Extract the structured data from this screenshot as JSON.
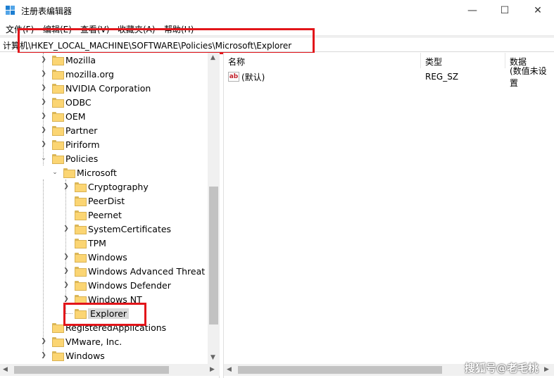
{
  "window": {
    "title": "注册表编辑器",
    "minimize": "—",
    "maximize": "☐",
    "close": "✕"
  },
  "menu": [
    "文件(F)",
    "编辑(E)",
    "查看(V)",
    "收藏夹(A)",
    "帮助(H)"
  ],
  "address": "计算机\\HKEY_LOCAL_MACHINE\\SOFTWARE\\Policies\\Microsoft\\Explorer",
  "tree": {
    "top_level": [
      "Mozilla",
      "mozilla.org",
      "NVIDIA Corporation",
      "ODBC",
      "OEM",
      "Partner",
      "Piriform",
      "Policies",
      "RegisteredApplications",
      "VMware, Inc.",
      "Windows"
    ],
    "policies_child": "Microsoft",
    "microsoft_children": [
      "Cryptography",
      "PeerDist",
      "Peernet",
      "SystemCertificates",
      "TPM",
      "Windows",
      "Windows Advanced Threat Pr",
      "Windows Defender",
      "Windows NT",
      "Explorer"
    ],
    "selected": "Explorer"
  },
  "list": {
    "columns": [
      "名称",
      "类型",
      "数据"
    ],
    "rows": [
      {
        "name": "(默认)",
        "type": "REG_SZ",
        "data": "(数值未设置"
      }
    ]
  },
  "watermark": "搜狐号@老毛桃",
  "colors": {
    "highlight_border": "#e2151a",
    "folder": "#fbd573"
  }
}
